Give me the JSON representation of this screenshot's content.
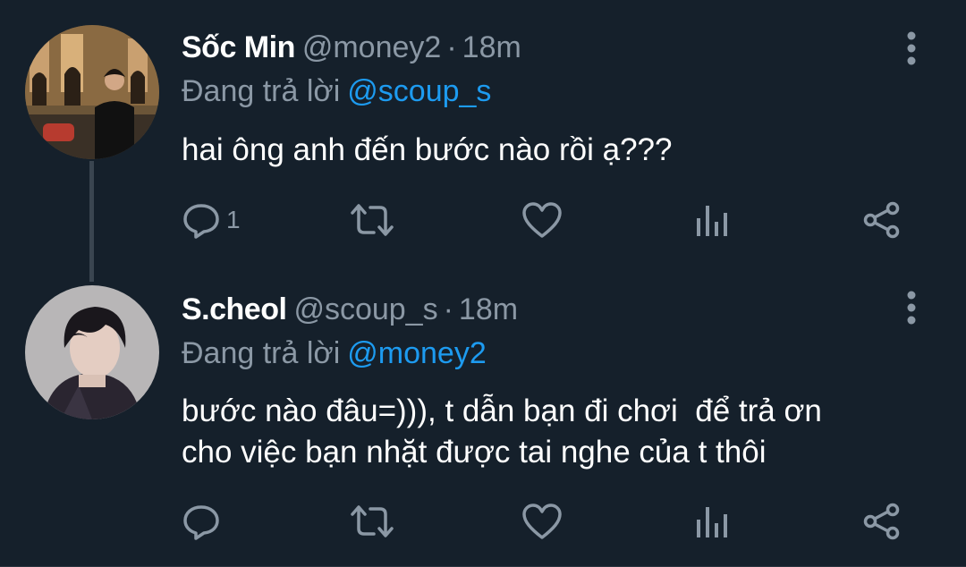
{
  "tweets": [
    {
      "display_name": "Sốc Min",
      "handle": "@money2",
      "separator": "·",
      "time": "18m",
      "replying_to_label": "Đang trả lời",
      "replying_to_handle": "@scoup_s",
      "text": "hai ông anh đến bước nào rồi ạ???",
      "reply_count": "1",
      "avatar_icon": "user-photo-avatar"
    },
    {
      "display_name": "S.cheol",
      "handle": "@scoup_s",
      "separator": "·",
      "time": "18m",
      "replying_to_label": "Đang trả lời",
      "replying_to_handle": "@money2",
      "text": "bước nào đâu=))), t dẫn bạn đi chơi  để trả ơn\ncho việc bạn nhặt được tai nghe của t thôi",
      "reply_count": "",
      "avatar_icon": "user-photo-avatar"
    }
  ],
  "colors": {
    "background": "#15202b",
    "text_primary": "#ffffff",
    "text_secondary": "#8b98a5",
    "link": "#1d9bf0"
  },
  "icons": [
    "reply-icon",
    "retweet-icon",
    "like-icon",
    "stats-icon",
    "share-icon",
    "more-icon"
  ]
}
